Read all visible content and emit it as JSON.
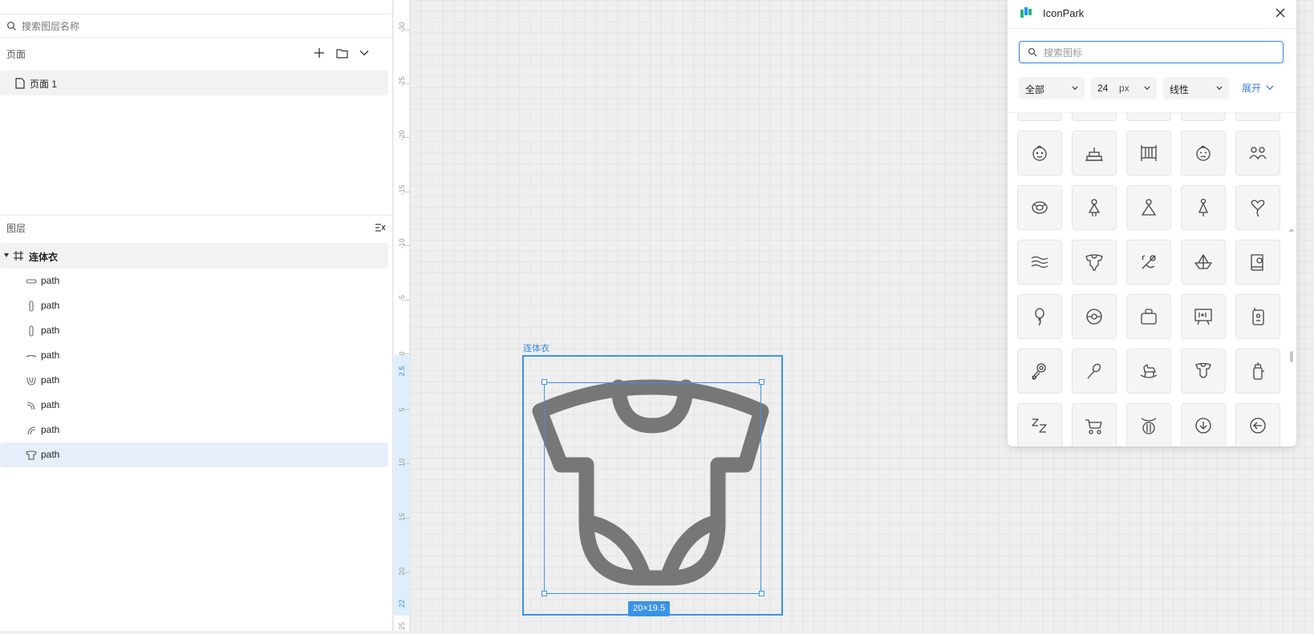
{
  "left_panel": {
    "search_placeholder": "搜索图层名称",
    "pages_title": "页面",
    "page_item": "页面 1",
    "layers_title": "图层",
    "frame_name": "连体衣",
    "layers": [
      "path",
      "path",
      "path",
      "path",
      "path",
      "path",
      "path",
      "path"
    ]
  },
  "ruler": {
    "labels": [
      "-30",
      "-25",
      "-20",
      "-15",
      "-10",
      "-5",
      "0",
      "2.5",
      "5",
      "10",
      "15",
      "20",
      "22",
      "25"
    ]
  },
  "canvas": {
    "frame_label": "连体衣",
    "dimensions": "20×19.5"
  },
  "iconpark": {
    "title": "IconPark",
    "search_placeholder": "搜索图标",
    "filter_category": "全部",
    "filter_size": "24",
    "filter_size_unit": "px",
    "filter_style": "线性",
    "expand_label": "展开",
    "icons": [
      "baby-face-icon",
      "birthday-cake-icon",
      "crib-icon",
      "crying-baby-icon",
      "family-icon",
      "swim-ring-icon",
      "girl-icon",
      "woman-icon",
      "girl-dress-icon",
      "heart-balloon-icon",
      "wave-icon",
      "onesie-icon",
      "pacifier-icon",
      "paper-boat-icon",
      "baby-book-icon",
      "balloon-icon",
      "ball-icon",
      "baby-box-icon",
      "blackboard-icon",
      "baby-phone-icon",
      "rattle-icon",
      "rattle-stick-icon",
      "rocking-horse-icon",
      "baby-onesie-icon",
      "baby-bottle-icon",
      "sleep-icon",
      "stroller-icon",
      "baby-mobile-icon",
      "down-circle-icon",
      "left-circle-icon"
    ]
  },
  "colors": {
    "accent": "#3a93e8",
    "onesie_stroke": "#777777",
    "link": "#3a7de8"
  }
}
